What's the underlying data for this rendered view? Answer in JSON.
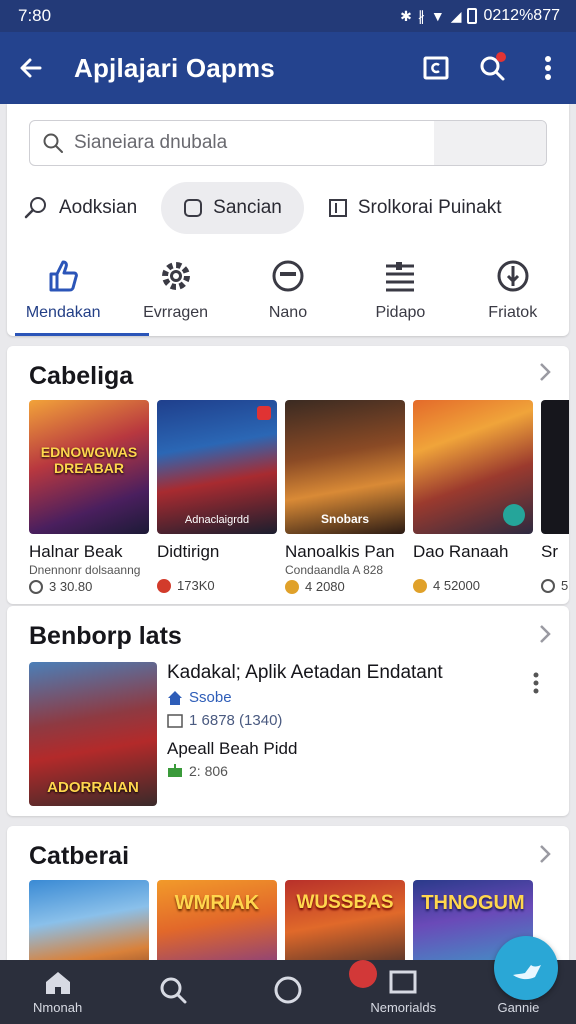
{
  "status": {
    "time": "7:80",
    "right": "0212%877"
  },
  "appbar": {
    "title": "Apjlajari Oapms"
  },
  "search": {
    "placeholder": "Sianeiara dnubala"
  },
  "chips": [
    {
      "label": "Aodksian"
    },
    {
      "label": "Sancian"
    },
    {
      "label": "Srolkorai Puinakt"
    }
  ],
  "categories": [
    {
      "label": "Mendakan",
      "icon": "thumbs-up-icon"
    },
    {
      "label": "Evrragen",
      "icon": "gear-icon"
    },
    {
      "label": "Nano",
      "icon": "minus-circle-icon"
    },
    {
      "label": "Pidapo",
      "icon": "list-icon"
    },
    {
      "label": "Friatok",
      "icon": "compass-icon"
    }
  ],
  "section1": {
    "title": "Cabeliga",
    "games": [
      {
        "name": "Halnar Beak",
        "sub": "Dnennonr dolsaanng",
        "meta": "3 30.80",
        "thumb_text": "EDNOWGWAS DREABAR",
        "icon_color": "#555555"
      },
      {
        "name": "Didtirign",
        "sub": "",
        "meta": "173K0",
        "thumb_text": "Adnaclaigrdd",
        "icon_color": "#d23b2b"
      },
      {
        "name": "Nanoalkis Pan",
        "sub": "Condaandla A 828",
        "meta": "4 2080",
        "thumb_text": "Snobars",
        "icon_color": "#e0a12a"
      },
      {
        "name": "Dao Ranaah",
        "sub": "",
        "meta": "4 52000",
        "thumb_text": "",
        "icon_color": "#e0a12a"
      },
      {
        "name": "Sr",
        "sub": "",
        "meta": "5",
        "thumb_text": "",
        "icon_color": "#555555"
      }
    ]
  },
  "section2": {
    "title": "Benborp lats",
    "featured": {
      "title": "Kadakal; Aplik Aetadan Endatant",
      "developer": "Ssobe",
      "rating": "1 6878 (1340)",
      "subtitle": "Apeall Beah Pidd",
      "downloads": "2: 806",
      "thumb_text": "ADORRAIAN"
    }
  },
  "section3": {
    "title": "Catberai",
    "games": [
      {
        "thumb_text": ""
      },
      {
        "thumb_text": "WMRIAK"
      },
      {
        "thumb_text": "WUSSBAS"
      },
      {
        "thumb_text": "THNOGUM"
      }
    ]
  },
  "bottom_nav": [
    {
      "label": "Nmonah",
      "icon": "home-icon"
    },
    {
      "label": "",
      "icon": "search-icon"
    },
    {
      "label": "",
      "icon": "circle-icon"
    },
    {
      "label": "Nemorialds",
      "icon": "square-icon"
    },
    {
      "label": "Gannie",
      "icon": "games-icon"
    }
  ]
}
